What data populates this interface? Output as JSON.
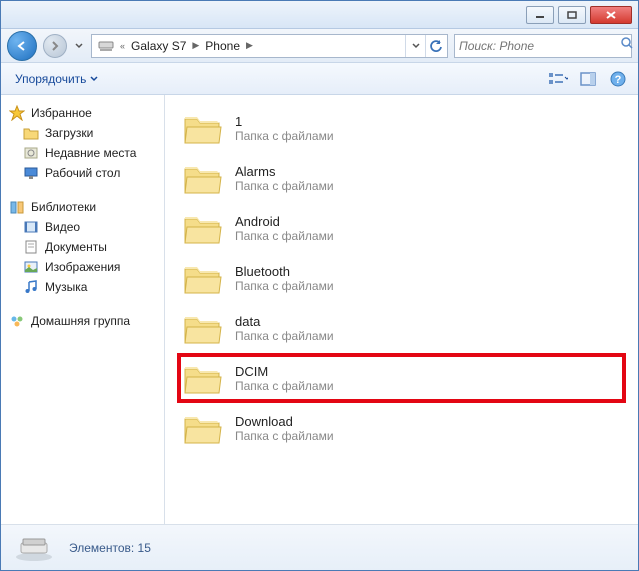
{
  "breadcrumb": {
    "parent": "Galaxy S7",
    "current": "Phone"
  },
  "search": {
    "placeholder": "Поиск: Phone"
  },
  "toolbar": {
    "organize": "Упорядочить"
  },
  "sidebar": {
    "favorites": {
      "header": "Избранное",
      "items": [
        "Загрузки",
        "Недавние места",
        "Рабочий стол"
      ]
    },
    "libraries": {
      "header": "Библиотеки",
      "items": [
        "Видео",
        "Документы",
        "Изображения",
        "Музыка"
      ]
    },
    "homegroup": {
      "header": "Домашняя группа"
    }
  },
  "folders": {
    "subtitle": "Папка с файлами",
    "items": [
      {
        "name": "1",
        "highlighted": false
      },
      {
        "name": "Alarms",
        "highlighted": false
      },
      {
        "name": "Android",
        "highlighted": false
      },
      {
        "name": "Bluetooth",
        "highlighted": false
      },
      {
        "name": "data",
        "highlighted": false
      },
      {
        "name": "DCIM",
        "highlighted": true
      },
      {
        "name": "Download",
        "highlighted": false
      }
    ]
  },
  "status": {
    "count_label": "Элементов: 15"
  }
}
